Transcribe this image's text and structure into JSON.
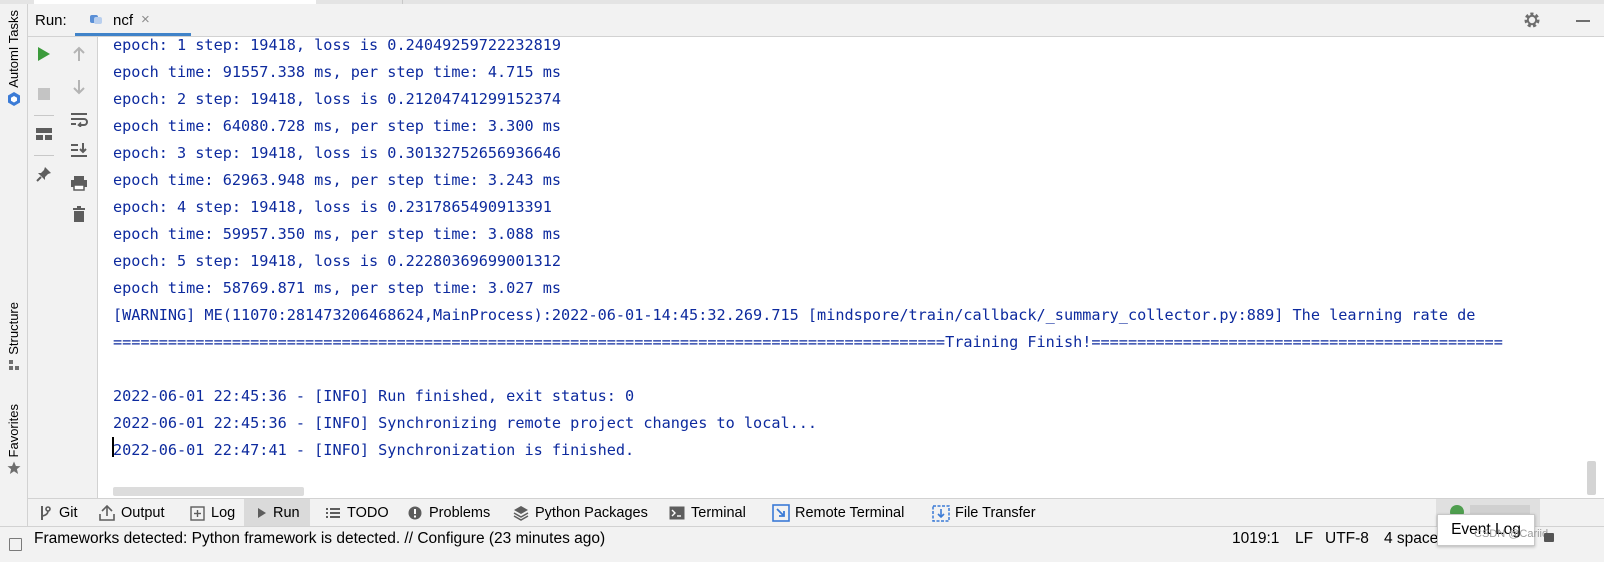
{
  "run_bar": {
    "label": "Run:",
    "tab_name": "ncf",
    "tab_close": "×"
  },
  "side_tools": {
    "automl_tasks": "AutomI Tasks",
    "structure": "Structure",
    "favorites": "Favorites"
  },
  "console": {
    "lines": [
      "epoch: 1 step: 19418, loss is 0.24049259722232819",
      "epoch time: 91557.338 ms, per step time: 4.715 ms",
      "epoch: 2 step: 19418, loss is 0.21204741299152374",
      "epoch time: 64080.728 ms, per step time: 3.300 ms",
      "epoch: 3 step: 19418, loss is 0.30132752656936646",
      "epoch time: 62963.948 ms, per step time: 3.243 ms",
      "epoch: 4 step: 19418, loss is 0.2317865490913391",
      "epoch time: 59957.350 ms, per step time: 3.088 ms",
      "epoch: 5 step: 19418, loss is 0.22280369699001312",
      "epoch time: 58769.871 ms, per step time: 3.027 ms",
      "[WARNING] ME(11070:281473206468624,MainProcess):2022-06-01-14:45:32.269.715 [mindspore/train/callback/_summary_collector.py:889] The learning rate de",
      "===========================================================================================Training Finish!=============================================",
      "",
      "2022-06-01 22:45:36 - [INFO] Run finished, exit status: 0",
      "2022-06-01 22:45:36 - [INFO] Synchronizing remote project changes to local...",
      "2022-06-01 22:47:41 - [INFO] Synchronization is finished."
    ]
  },
  "bottom_tabs": [
    {
      "label": "Git",
      "icon": "git-branch-icon"
    },
    {
      "label": "Output",
      "icon": "upload-icon"
    },
    {
      "label": "Log",
      "icon": "plus-box-icon"
    },
    {
      "label": "Run",
      "icon": "play-icon",
      "active": true
    },
    {
      "label": "TODO",
      "icon": "list-icon"
    },
    {
      "label": "Problems",
      "icon": "info-icon"
    },
    {
      "label": "Python Packages",
      "icon": "layers-icon"
    },
    {
      "label": "Terminal",
      "icon": "terminal-icon"
    },
    {
      "label": "Remote Terminal",
      "icon": "remote-terminal-icon"
    },
    {
      "label": "File Transfer",
      "icon": "file-transfer-icon"
    }
  ],
  "status_bar": {
    "message": "Frameworks detected: Python framework is detected. // Configure (23 minutes ago)",
    "position": "1019:1",
    "line_sep": "LF",
    "encoding": "UTF-8",
    "indent": "4 space"
  },
  "popup": {
    "event_log": "Event Log"
  },
  "watermark": "CSDN @Cariid",
  "colors": {
    "console_text": "#0d2a9e",
    "tab_underline": "#4083c9",
    "run_green": "#3c9b3c"
  }
}
